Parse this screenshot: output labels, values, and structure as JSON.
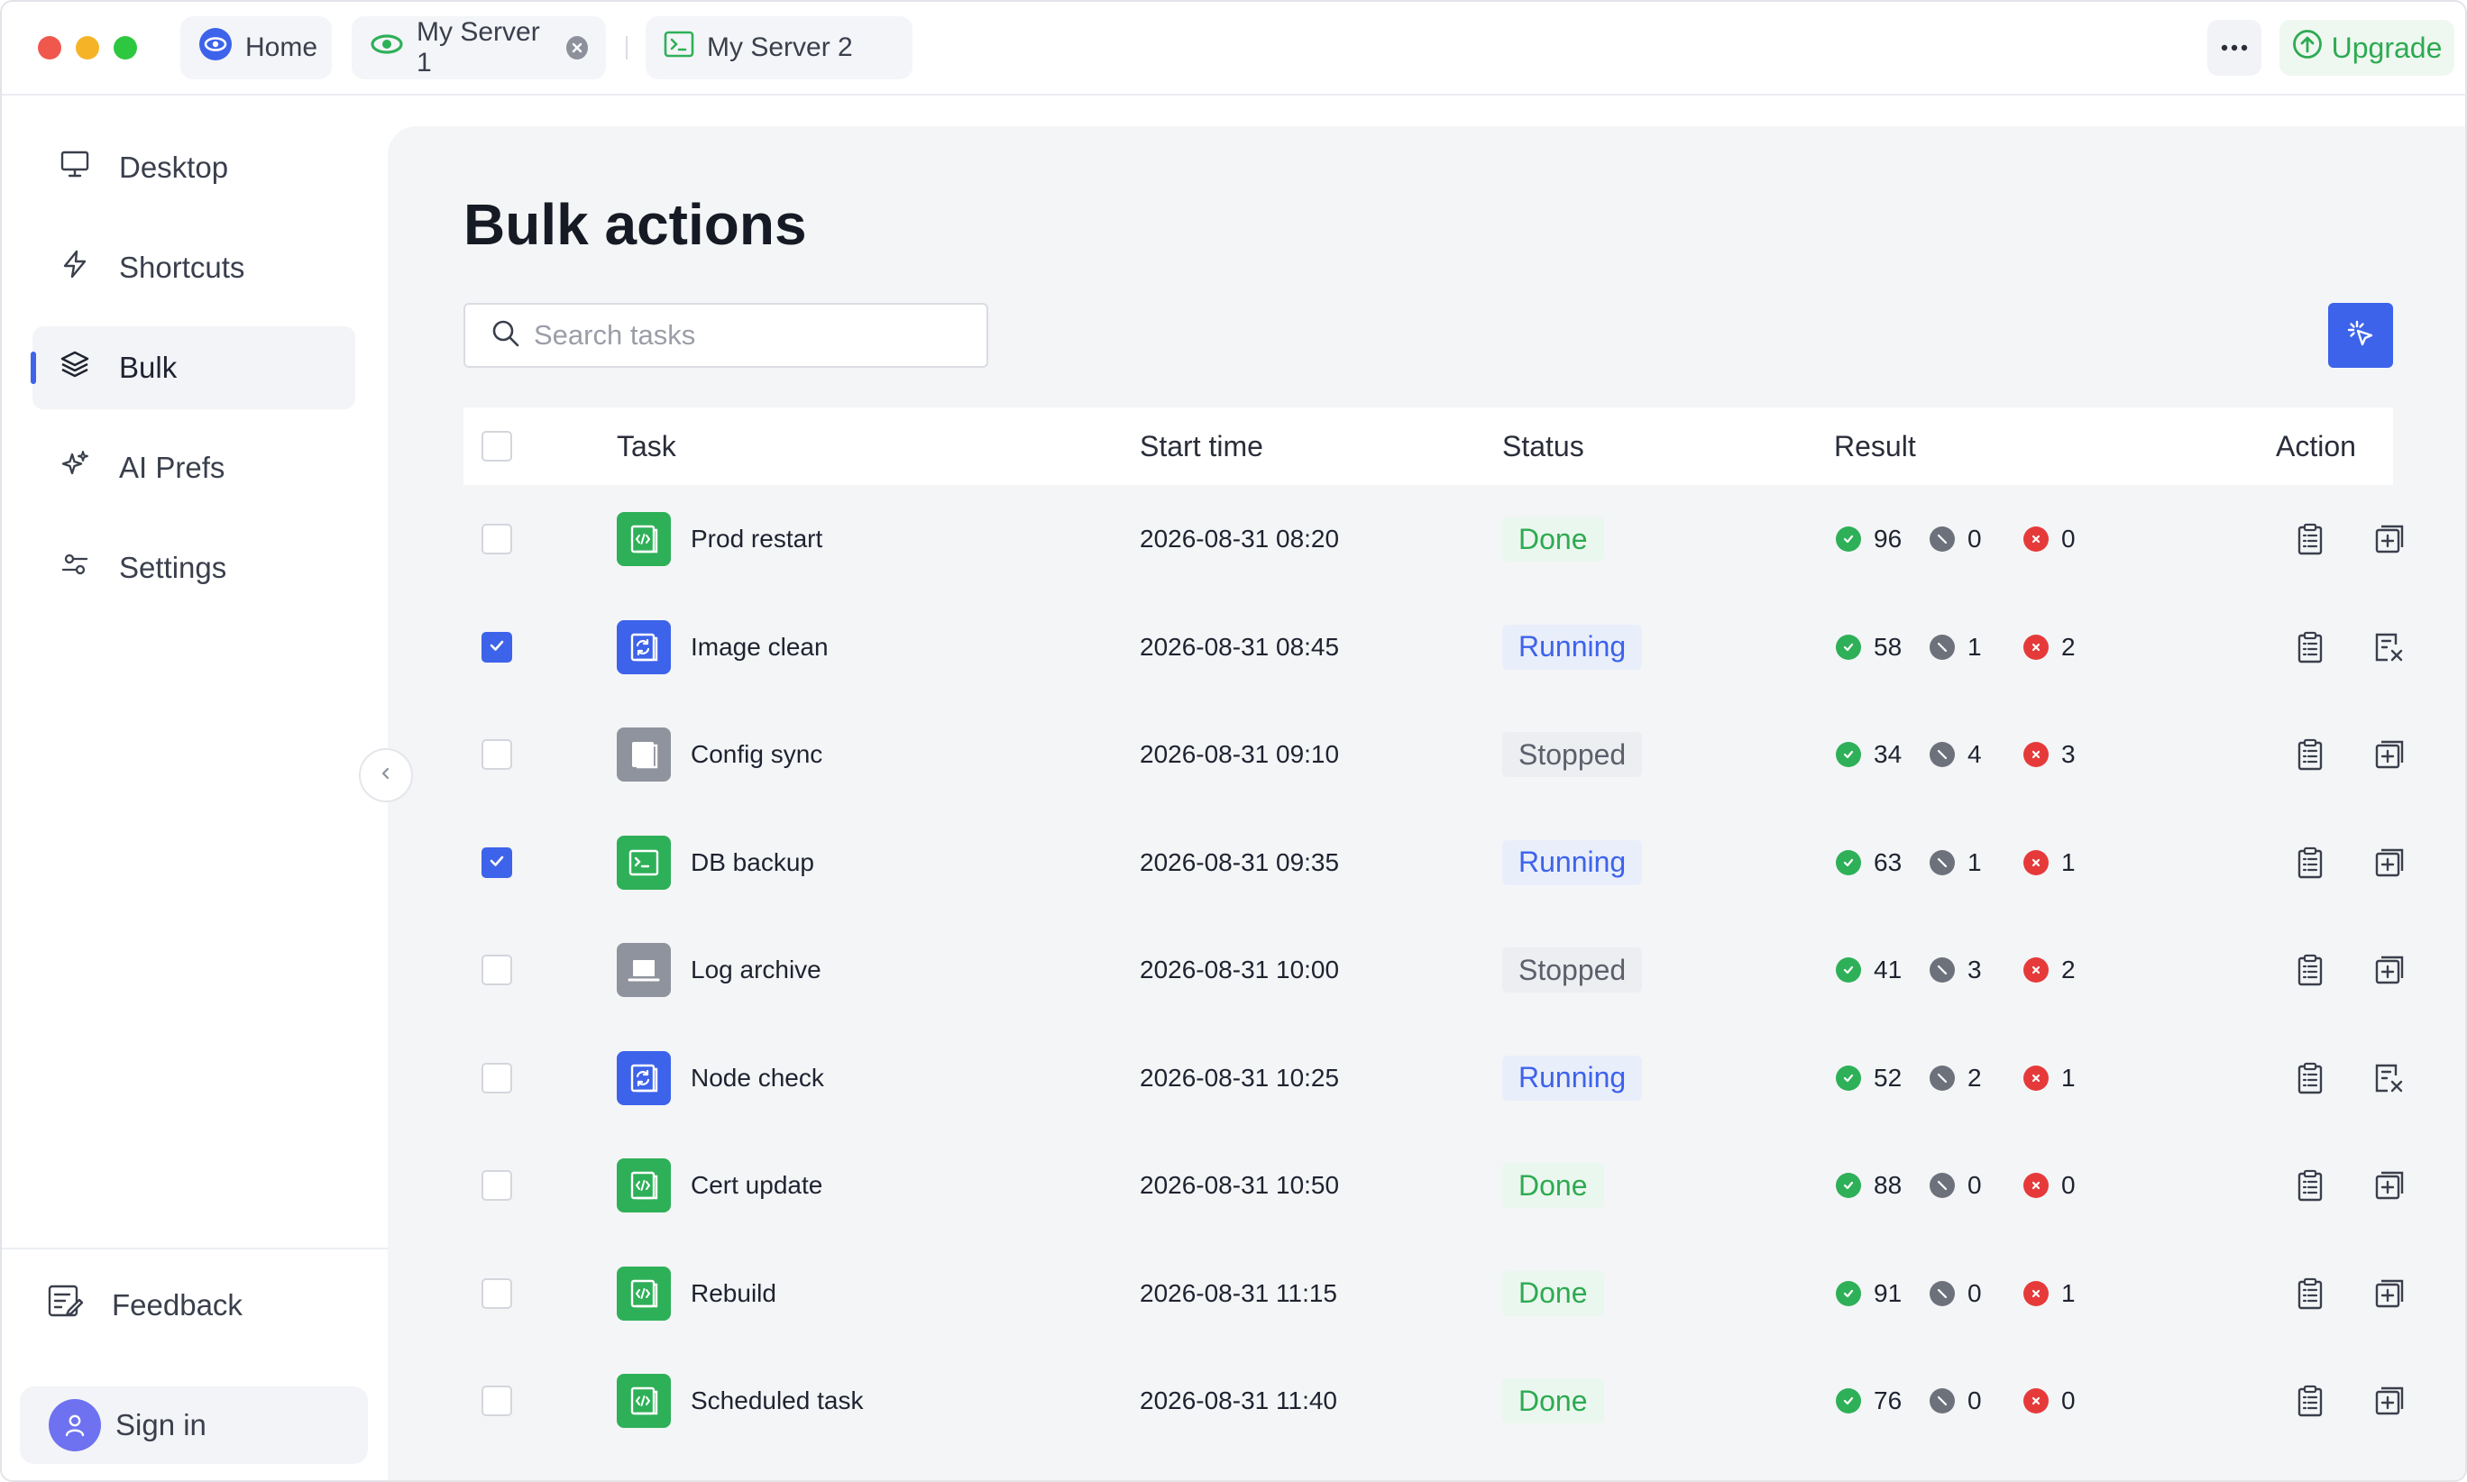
{
  "tabs": [
    {
      "label": "Home",
      "icon": "eye-icon"
    },
    {
      "label": "My Server 1",
      "icon": "eye-icon"
    },
    {
      "label": "My Server 2",
      "icon": "terminal-icon"
    }
  ],
  "header": {
    "upgrade_label": "Upgrade"
  },
  "sidebar": {
    "items": [
      {
        "label": "Desktop",
        "icon": "monitor-icon"
      },
      {
        "label": "Shortcuts",
        "icon": "lightning-icon"
      },
      {
        "label": "Bulk",
        "icon": "layers-icon",
        "active": true
      },
      {
        "label": "AI Prefs",
        "icon": "sparkle-icon"
      },
      {
        "label": "Settings",
        "icon": "sliders-icon"
      }
    ],
    "feedback_label": "Feedback",
    "signin_label": "Sign in"
  },
  "main": {
    "title": "Bulk actions",
    "search_placeholder": "Search tasks",
    "columns": [
      "Task",
      "Start time",
      "Status",
      "Result",
      "Action"
    ],
    "rows": [
      {
        "task": "Prod restart",
        "icon": "code-icon",
        "icon_color": "green",
        "checked": false,
        "start": "2026-08-31 08:20",
        "status": "Done",
        "ok": "96",
        "skipped": "0",
        "failed": "0",
        "action2": "add"
      },
      {
        "task": "Image clean",
        "icon": "refresh-icon",
        "icon_color": "blue",
        "checked": true,
        "start": "2026-08-31 08:45",
        "status": "Running",
        "ok": "58",
        "skipped": "1",
        "failed": "2",
        "action2": "cancel"
      },
      {
        "task": "Config sync",
        "icon": "document-icon",
        "icon_color": "gray",
        "checked": false,
        "start": "2026-08-31 09:10",
        "status": "Stopped",
        "ok": "34",
        "skipped": "4",
        "failed": "3",
        "action2": "add"
      },
      {
        "task": "DB backup",
        "icon": "terminal-icon",
        "icon_color": "green",
        "checked": true,
        "start": "2026-08-31 09:35",
        "status": "Running",
        "ok": "63",
        "skipped": "1",
        "failed": "1",
        "action2": "add"
      },
      {
        "task": "Log archive",
        "icon": "laptop-icon",
        "icon_color": "gray",
        "checked": false,
        "start": "2026-08-31 10:00",
        "status": "Stopped",
        "ok": "41",
        "skipped": "3",
        "failed": "2",
        "action2": "add"
      },
      {
        "task": "Node check",
        "icon": "refresh-icon",
        "icon_color": "blue",
        "checked": false,
        "start": "2026-08-31 10:25",
        "status": "Running",
        "ok": "52",
        "skipped": "2",
        "failed": "1",
        "action2": "cancel"
      },
      {
        "task": "Cert update",
        "icon": "code-icon",
        "icon_color": "green",
        "checked": false,
        "start": "2026-08-31 10:50",
        "status": "Done",
        "ok": "88",
        "skipped": "0",
        "failed": "0",
        "action2": "add"
      },
      {
        "task": "Rebuild",
        "icon": "code-icon",
        "icon_color": "green",
        "checked": false,
        "start": "2026-08-31 11:15",
        "status": "Done",
        "ok": "91",
        "skipped": "0",
        "failed": "1",
        "action2": "add"
      },
      {
        "task": "Scheduled task",
        "icon": "code-icon",
        "icon_color": "green",
        "checked": false,
        "start": "2026-08-31 11:40",
        "status": "Done",
        "ok": "76",
        "skipped": "0",
        "failed": "0",
        "action2": "add"
      }
    ]
  },
  "colors": {
    "accent": "#3d63ea",
    "success": "#2eb058",
    "error": "#e63a3a",
    "neutral": "#8f939d"
  }
}
